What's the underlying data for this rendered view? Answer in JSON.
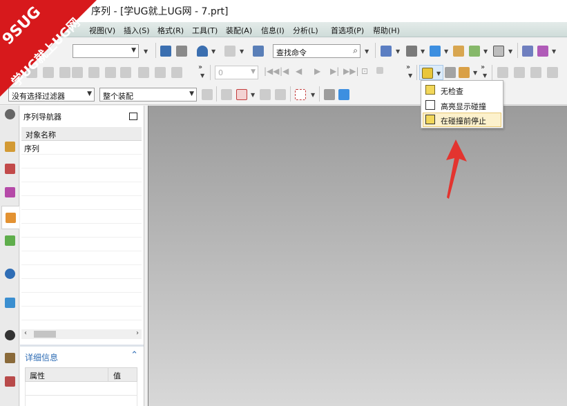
{
  "window": {
    "title": "序列 - [学UG就上UG网 - 7.prt]"
  },
  "watermark": {
    "line1": "9SUG",
    "line2": "学UG就上UG网",
    "color": "#d7191c"
  },
  "menu": [
    {
      "label": "视图(V)"
    },
    {
      "label": "插入(S)"
    },
    {
      "label": "格式(R)"
    },
    {
      "label": "工具(T)"
    },
    {
      "label": "装配(A)"
    },
    {
      "label": "信息(I)"
    },
    {
      "label": "分析(L)"
    },
    {
      "label": "首选项(P)"
    },
    {
      "label": "帮助(H)"
    }
  ],
  "toolbar": {
    "command_search_placeholder": "查找命令",
    "frame_field_value": "0",
    "selection_filter_value": "没有选择过滤器",
    "scope_value": "整个装配"
  },
  "navigator": {
    "title": "序列导航器",
    "column_header": "对象名称",
    "rows": [
      "序列"
    ]
  },
  "details": {
    "title": "详细信息",
    "col_property": "属性",
    "col_value": "值"
  },
  "collision_menu": {
    "items": [
      {
        "label": "无检查",
        "highlighted": false
      },
      {
        "label": "高亮显示碰撞",
        "highlighted": false
      },
      {
        "label": "在碰撞前停止",
        "highlighted": true
      }
    ]
  },
  "colors": {
    "accent_blue": "#2f6db5",
    "highlight": "#fcf1cc",
    "arrow_red": "#e3342f"
  }
}
